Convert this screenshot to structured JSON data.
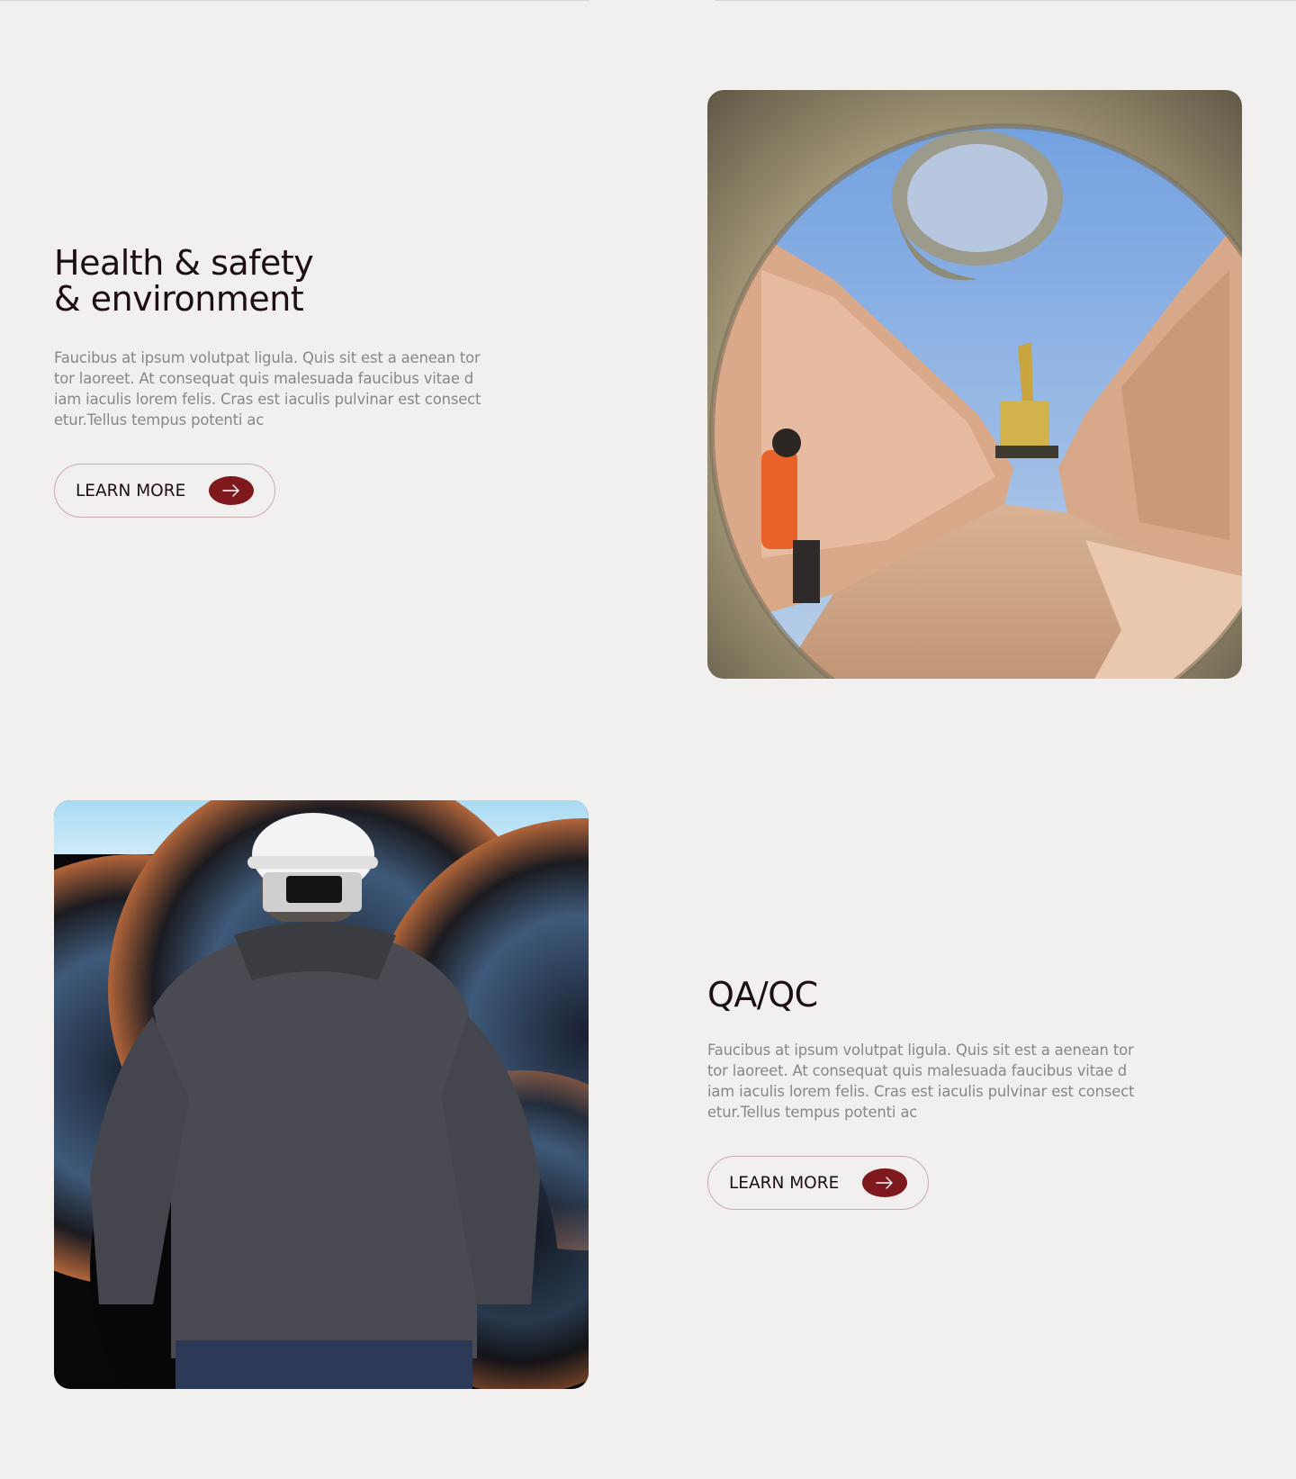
{
  "sections": [
    {
      "title_line1": "Health & safety",
      "title_line2": "& environment",
      "body": "Faucibus at ipsum volutpat ligula. Quis sit est a aenean tor tor laoreet. At consequat quis malesuada faucibus vitae d iam iaculis lorem felis. Cras est iaculis pulvinar est consect etur.Tellus tempus potenti ac",
      "button_label": "LEARN MORE",
      "image_icon": "pipe-trench-photo"
    },
    {
      "title_line1": "QA/QC",
      "body": "Faucibus at ipsum volutpat ligula. Quis sit est a aenean tor tor laoreet. At consequat quis malesuada faucibus vitae d iam iaculis lorem felis. Cras est iaculis pulvinar est consect etur.Tellus tempus potenti ac",
      "button_label": "LEARN MORE",
      "image_icon": "worker-hardhat-photo"
    }
  ],
  "colors": {
    "background": "#f2f0ef",
    "heading": "#1b0f10",
    "body_text": "#8b8584",
    "accent": "#7e1a1e",
    "button_border": "#c9a9ab"
  }
}
